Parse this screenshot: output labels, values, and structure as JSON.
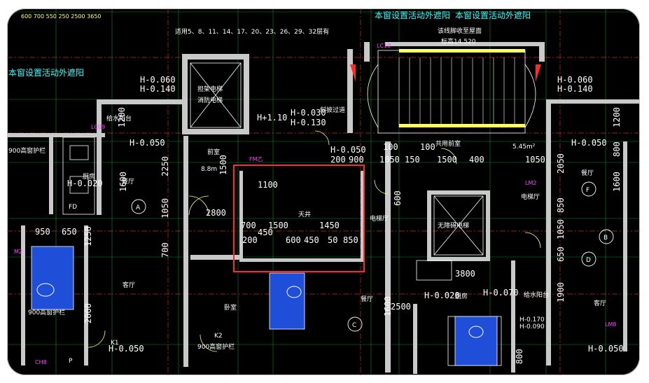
{
  "colors": {
    "background": "#000000",
    "wall": "#c9c9c9",
    "dimension": "#00ff66",
    "axis": "#ff3030",
    "text": "#ffffff",
    "annotation": "#35ffff",
    "tag": "#ff40ff",
    "highlight_box": "#ff2a2a",
    "bathroom_fill": "#1f4fd8"
  },
  "notes": {
    "sunshade_top_left": "本窗设置活动外遮阳",
    "sunshade_top_right": "本窗设置活动外遮阳",
    "floors_note": "适用5、8、11、14、17、20、23、26、29、32层有",
    "sunshade_left": "本窗设置活动外遮阳",
    "elev_note_line1": "该线脚收至屋面",
    "elev_note_line2": "标高14.520"
  },
  "elevations": {
    "left_top": "H-0.060",
    "left_bottom": "H-0.140",
    "right_top": "H-0.060",
    "right_bottom": "H-0.140",
    "mid_top": "H-0.030",
    "mid_bottom": "H-0.130",
    "h_plus": "H+1.10",
    "h_050_left": "H-0.050",
    "h_050_mid": "H-0.050",
    "h_050_right": "H-0.050",
    "h_020_left": "H-0.020",
    "h_020_right": "H-0.020",
    "h_070": "H-0.070",
    "h_170": "H-0.170",
    "h_090": "H-0.090",
    "h_050_bottom_left": "H-0.050",
    "h_050_bottom_right": "H-0.050",
    "area": "5.45m²"
  },
  "rooms": {
    "elevator_shaft": "担架电梯",
    "elevator_shaft_2": "消防电梯",
    "front_room": "前室",
    "corridor": "斜披过道",
    "public_front": "共用前室",
    "living_left": "餐厅",
    "kitchen": "厨房",
    "shaft": "天井",
    "elevator_hall": "电梯厅",
    "elevator_hall_2": "电梯厅",
    "barrier_free_elevator": "无障碍电梯",
    "dining_right": "餐厅",
    "living_right": "客厅",
    "living_left_2": "客厅",
    "bedroom": "卧室",
    "dining_mid": "餐厅",
    "kitchen_right": "厨房",
    "balcony_right": "给水阳台",
    "balcony_left": "给水阳台",
    "guard_left": "900高窗护栏",
    "guard_left_2": "900高窗护栏",
    "guard_mid": "900高窗护栏",
    "height_label": "8.8m"
  },
  "dimensions": {
    "d1100": "1100",
    "d700": "700",
    "d1500": "1500",
    "d1450": "1450",
    "d450": "450",
    "d200": "200",
    "d600": "600",
    "d4505": "450",
    "d5095": "50",
    "d850": "850",
    "d2800": "2800",
    "d950": "950",
    "d650": "650",
    "d100a": "100",
    "d100b": "100",
    "d900": "900",
    "d1050": "1050",
    "d150": "150",
    "d400": "400",
    "d1050b": "1050",
    "d200b": "200",
    "d1500b": "1500",
    "d2250": "2250",
    "d1500c": "1500",
    "d1600": "1600",
    "d1050c": "1050",
    "d800": "800",
    "d2050": "2050",
    "d1600b": "1600",
    "d850b": "850",
    "d1050d": "1050",
    "d650b": "650",
    "d1900": "1900",
    "d2500": "2500",
    "d1600c": "1600",
    "d2000": "2000",
    "d1250": "1250",
    "d1200": "1200",
    "d1200b": "1200",
    "d3800": "3800",
    "d800b": "800",
    "d700b": "700",
    "d600b": "600"
  },
  "axes": [
    "A",
    "B",
    "C",
    "D",
    "F"
  ],
  "tags": [
    "LC09",
    "FM乙",
    "LM2",
    "LM8",
    "M2",
    "K1",
    "K2",
    "P",
    "FD",
    "LC10",
    "CH8"
  ],
  "highlight": "selected-region"
}
